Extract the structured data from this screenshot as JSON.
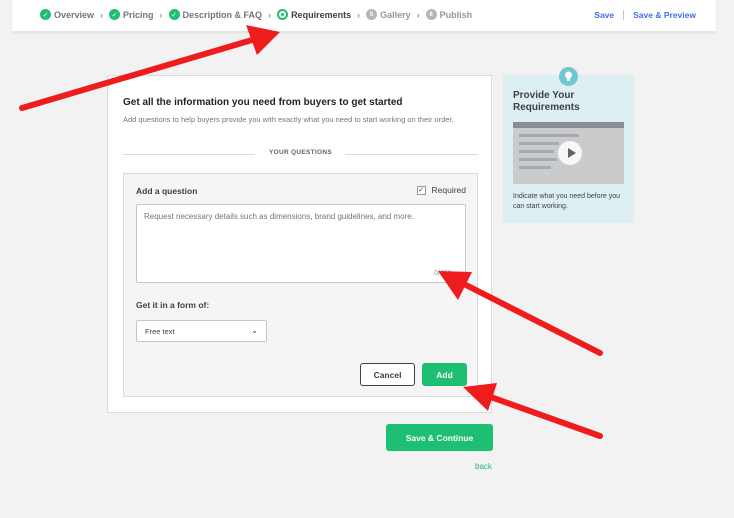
{
  "steps": [
    {
      "label": "Overview",
      "state": "done"
    },
    {
      "label": "Pricing",
      "state": "done"
    },
    {
      "label": "Description & FAQ",
      "state": "done"
    },
    {
      "label": "Requirements",
      "state": "current"
    },
    {
      "label": "Gallery",
      "state": "todo",
      "num": "5"
    },
    {
      "label": "Publish",
      "state": "todo",
      "num": "6"
    }
  ],
  "toplinks": {
    "save": "Save",
    "save_preview": "Save & Preview"
  },
  "card": {
    "title": "Get all the information you need from buyers to get started",
    "subtitle": "Add questions to help buyers provide you with exactly what you need to start working on their order.",
    "section_label": "YOUR QUESTIONS"
  },
  "question": {
    "label": "Add a question",
    "required_label": "Required",
    "required_checked": true,
    "placeholder": "Request necessary details such as dimensions, brand guidelines, and more.",
    "counter": "0/450",
    "form_label": "Get it in a form of:",
    "form_value": "Free text",
    "cancel_label": "Cancel",
    "add_label": "Add"
  },
  "footer": {
    "save_continue": "Save & Continue",
    "back": "back"
  },
  "tip": {
    "title": "Provide Your Requirements",
    "text": "Indicate what you need before you can start working."
  },
  "colors": {
    "accent": "#1dbf73",
    "link": "#446ee7",
    "arrow": "#ee1c1c",
    "tip_bg": "#ddeff0"
  },
  "icons": {
    "done": "check-circle-icon",
    "current": "location-pin-icon",
    "tip": "lightbulb-icon",
    "video": "play-icon"
  }
}
